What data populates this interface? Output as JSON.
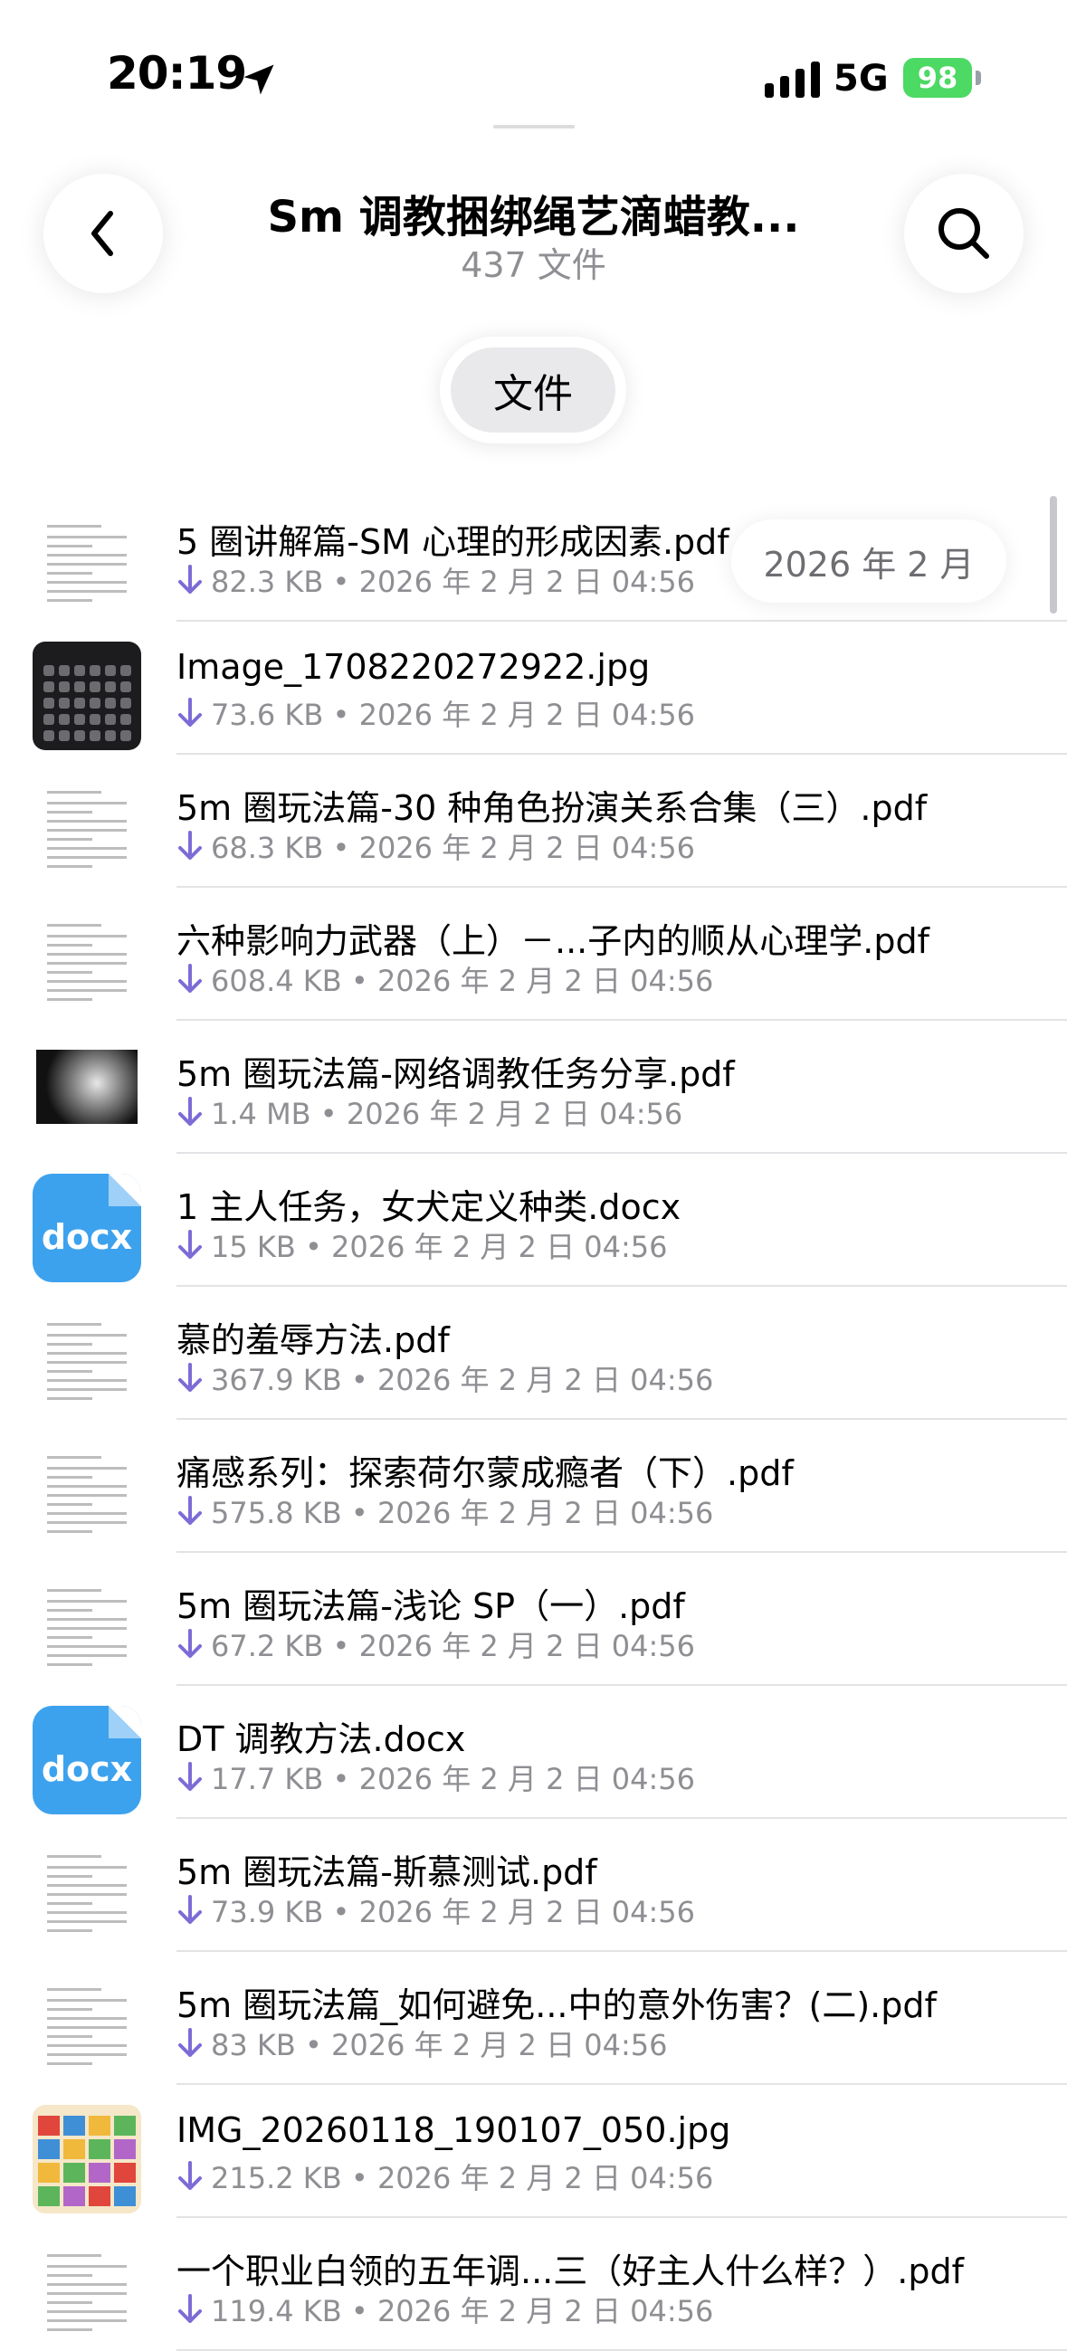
{
  "status_bar": {
    "time": "20:19",
    "network": "5G",
    "battery": "98"
  },
  "header": {
    "title": "Sm 调教捆绑绳艺滴蜡教...",
    "subtitle": "437 文件",
    "segment": "文件"
  },
  "month_label": "2026 年 2 月",
  "files": [
    {
      "name": "5 圈讲解篇-SM 心理的形成因素.pdf",
      "meta": "82.3 KB • 2026 年 2 月 2 日 04:56",
      "thumb": "doc"
    },
    {
      "name": "Image_1708220272922.jpg",
      "meta": "73.6 KB • 2026 年 2 月 2 日 04:56",
      "thumb": "dark"
    },
    {
      "name": "5m 圈玩法篇-30 种角色扮演关系合集（三）.pdf",
      "meta": "68.3 KB • 2026 年 2 月 2 日 04:56",
      "thumb": "doc"
    },
    {
      "name": "六种影响力武器（上）－...子内的顺从心理学.pdf",
      "meta": "608.4 KB • 2026 年 2 月 2 日 04:56",
      "thumb": "doc"
    },
    {
      "name": "5m 圈玩法篇-网络调教任务分享.pdf",
      "meta": "1.4 MB • 2026 年 2 月 2 日 04:56",
      "thumb": "photo"
    },
    {
      "name": "1 主人任务，女犬定义种类.docx",
      "meta": "15 KB • 2026 年 2 月 2 日 04:56",
      "thumb": "docx"
    },
    {
      "name": "慕的羞辱方法.pdf",
      "meta": "367.9 KB • 2026 年 2 月 2 日 04:56",
      "thumb": "doc"
    },
    {
      "name": "痛感系列：探索荷尔蒙成瘾者（下）.pdf",
      "meta": "575.8 KB • 2026 年 2 月 2 日 04:56",
      "thumb": "doc"
    },
    {
      "name": "5m 圈玩法篇-浅论 SP（一）.pdf",
      "meta": "67.2 KB • 2026 年 2 月 2 日 04:56",
      "thumb": "doc"
    },
    {
      "name": "DT 调教方法.docx",
      "meta": "17.7 KB • 2026 年 2 月 2 日 04:56",
      "thumb": "docx"
    },
    {
      "name": "5m 圈玩法篇-斯慕测试.pdf",
      "meta": "73.9 KB • 2026 年 2 月 2 日 04:56",
      "thumb": "doc"
    },
    {
      "name": "5m 圈玩法篇_如何避免...中的意外伤害？(二).pdf",
      "meta": "83 KB • 2026 年 2 月 2 日 04:56",
      "thumb": "doc"
    },
    {
      "name": "IMG_20260118_190107_050.jpg",
      "meta": "215.2 KB • 2026 年 2 月 2 日 04:56",
      "thumb": "colorful"
    },
    {
      "name": "一个职业白领的五年调...三（好主人什么样？）.pdf",
      "meta": "119.4 KB • 2026 年 2 月 2 日 04:56",
      "thumb": "doc"
    }
  ],
  "docx_label": "docx",
  "colors": {
    "accent": "#7d6bd6",
    "battery": "#4cd964",
    "secondary_text": "#8e8e93"
  },
  "icons": {
    "back": "chevron-left-icon",
    "search": "magnifier-icon",
    "download": "arrow-down-icon"
  }
}
